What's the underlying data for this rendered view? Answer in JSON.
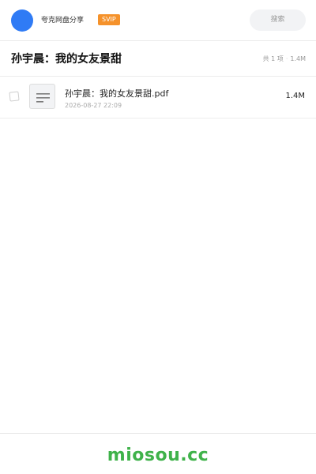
{
  "header": {
    "sharer_name": "夸克网盘分享",
    "badge": "SVIP",
    "search_placeholder": "搜索",
    "avatar_color": "#2f7bf5",
    "badge_color": "#f5922b"
  },
  "folder": {
    "title": "孙宇晨：我的女友景甜",
    "count": "共 1 项",
    "total_size": "1.4M"
  },
  "files": [
    {
      "name": "孙宇晨：我的女友景甜.pdf",
      "date": "2026-08-27 22:09",
      "size": "1.4M",
      "icon": "document-lines-icon"
    }
  ],
  "footer": {
    "brand": "miosou.cc",
    "brand_color": "#3fb24a"
  }
}
